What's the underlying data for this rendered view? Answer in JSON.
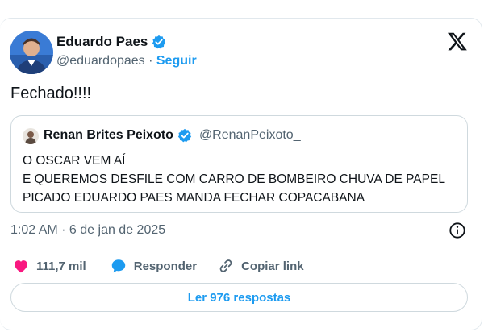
{
  "author": {
    "name": "Eduardo Paes",
    "handle": "@eduardopaes",
    "separator": " · ",
    "follow_label": "Seguir"
  },
  "tweet": {
    "text": "Fechado!!!!"
  },
  "quote": {
    "name": "Renan Brites Peixoto",
    "handle": "@RenanPeixoto_",
    "lines": [
      "O OSCAR VEM AÍ",
      "E QUEREMOS DESFILE COM CARRO DE BOMBEIRO CHUVA DE PAPEL",
      "PICADO EDUARDO PAES MANDA FECHAR COPACABANA"
    ]
  },
  "timestamp": "1:02 AM · 6 de jan de 2025",
  "actions": {
    "likes": "111,7 mil",
    "reply_label": "Responder",
    "copy_link_label": "Copiar link"
  },
  "read_replies_label": "Ler 976 respostas",
  "colors": {
    "accent": "#1d9bf0",
    "like": "#f91880",
    "muted": "#536471",
    "text": "#0f1419"
  },
  "icons": [
    "verified-badge-icon",
    "x-logo-icon",
    "info-icon",
    "heart-icon",
    "reply-bubble-icon",
    "link-icon"
  ]
}
